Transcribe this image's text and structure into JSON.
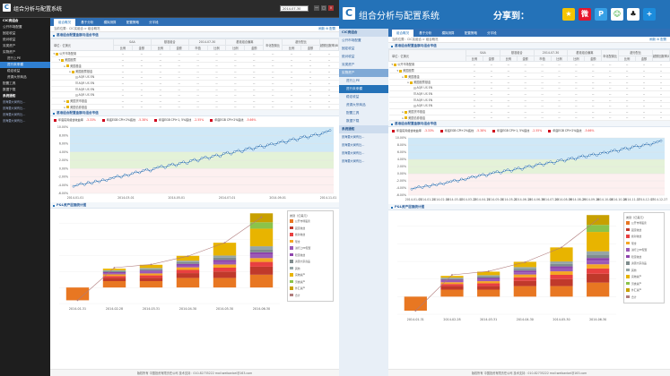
{
  "left": {
    "app_title": "组合分析与配置系统",
    "date": "2014-07-30",
    "win_buttons": [
      "—",
      "□",
      "×"
    ],
    "sidebar": [
      {
        "label": "CIC资组合",
        "cls": "hdr"
      },
      {
        "label": "公开市场配置",
        "cls": ""
      },
      {
        "label": "固定收益",
        "cls": ""
      },
      {
        "label": "绝对收益",
        "cls": ""
      },
      {
        "label": "另类资产",
        "cls": ""
      },
      {
        "label": "实物资产",
        "cls": ""
      },
      {
        "label": "进行上PE",
        "cls": "sub"
      },
      {
        "label": "进行未来模",
        "cls": "sub sel"
      },
      {
        "label": "稳定收益",
        "cls": "sub"
      },
      {
        "label": "资源大宗商品",
        "cls": "sub"
      },
      {
        "label": "配置工具",
        "cls": ""
      },
      {
        "label": "数据下载",
        "cls": ""
      },
      {
        "label": "系统通知",
        "cls": "hdr"
      },
      {
        "label": "张海要大局有比...",
        "cls": "ns"
      },
      {
        "label": "张海要大局有比...",
        "cls": "ns"
      },
      {
        "label": "张海要大局有比...",
        "cls": "ns"
      },
      {
        "label": "张海要大局有比...",
        "cls": "ns"
      }
    ]
  },
  "right": {
    "app_title": "组合分析与配置系统",
    "share_label": "分享到：",
    "share_icons": [
      {
        "name": "qzone",
        "glyph": "★",
        "bg": "#f5c400",
        "fg": "#fff"
      },
      {
        "name": "weibo",
        "glyph": "微",
        "bg": "#e6162d",
        "fg": "#fff"
      },
      {
        "name": "tencent-weibo",
        "glyph": "P",
        "bg": "#37a0e6",
        "fg": "#fff"
      },
      {
        "name": "wechat",
        "glyph": "☺",
        "bg": "#fff",
        "fg": "#2aa52a"
      },
      {
        "name": "qq",
        "glyph": "♣",
        "bg": "#fff",
        "fg": "#111"
      },
      {
        "name": "more",
        "glyph": "+",
        "bg": "#1c8cdc",
        "fg": "#fff"
      }
    ],
    "sidebar": [
      {
        "label": "CIC资组合",
        "cls": "hdr"
      },
      {
        "label": "公开市场配置",
        "cls": ""
      },
      {
        "label": "固定收益",
        "cls": ""
      },
      {
        "label": "绝对收益",
        "cls": ""
      },
      {
        "label": "另类资产",
        "cls": ""
      },
      {
        "label": "实物资产",
        "cls": "hdr2"
      },
      {
        "label": "进行上PE",
        "cls": "sub"
      },
      {
        "label": "进行未来模",
        "cls": "sub sel"
      },
      {
        "label": "稳定收益",
        "cls": "sub"
      },
      {
        "label": "资源大宗商品",
        "cls": "sub"
      },
      {
        "label": "配置工具",
        "cls": "sub"
      },
      {
        "label": "数据下载",
        "cls": "sub"
      },
      {
        "label": "系统通知",
        "cls": "hdr"
      },
      {
        "label": "张海要大局有比...",
        "cls": "ns"
      },
      {
        "label": "张海要大局有比...",
        "cls": "ns"
      },
      {
        "label": "张海要大局有比...",
        "cls": "ns"
      },
      {
        "label": "张海要大局有比...",
        "cls": "ns"
      }
    ]
  },
  "tabs": [
    "组合概况",
    "基于分析",
    "模拟测算",
    "配置策略",
    "分字段"
  ],
  "breadcrumb": "当前位置：CIC实组合 > 组合概况",
  "crumb_right": "刷新  ⚙ 配置",
  "section1": "基准组合配置金额与组合市值",
  "table": {
    "unit": "单位：亿美元",
    "group_headers": [
      "SAA",
      "基准组合",
      "2014-07-30",
      "基准组合偏离",
      "年化配置比",
      "超分配比",
      "超额回报率(BPS)"
    ],
    "sub_headers": [
      "比例",
      "金额",
      "比例",
      "金额",
      "市值",
      "比例",
      "比例",
      "金额"
    ],
    "rows": [
      {
        "name": "公开市场配置",
        "level": 0,
        "icon": "#e8b400",
        "arrow": "▾",
        "vals": [
          "--",
          "--",
          "--",
          "--",
          "--",
          "--",
          "--",
          "--",
          "--",
          "--",
          "--",
          "--"
        ]
      },
      {
        "name": "美国股票",
        "level": 1,
        "icon": "#e8b400",
        "arrow": "▾",
        "vals": [
          "--",
          "--",
          "--",
          "--",
          "--",
          "--",
          "--",
          "--",
          "--",
          "--",
          "--",
          "--"
        ]
      },
      {
        "name": "美国基金",
        "level": 2,
        "icon": "#e8b400",
        "arrow": "▸",
        "vals": [
          "--",
          "--",
          "--",
          "--",
          "--",
          "--",
          "--",
          "--",
          "--",
          "--",
          "--",
          "--"
        ]
      },
      {
        "name": "美国股票基金",
        "level": 3,
        "icon": "#e8b400",
        "arrow": "▸",
        "vals": [
          "--",
          "--",
          "--",
          "--",
          "--",
          "--",
          "--",
          "--",
          "--",
          "--",
          "--",
          "--"
        ]
      },
      {
        "name": "AQR US EN",
        "level": 4,
        "icon": "#cfcfcf",
        "arrow": "",
        "vals": [
          "--",
          "--",
          "--",
          "--",
          "--",
          "--",
          "--",
          "--",
          "--",
          "--",
          "--",
          "--"
        ]
      },
      {
        "name": "AQR US EN",
        "level": 4,
        "icon": "#cfcfcf",
        "arrow": "",
        "vals": [
          "--",
          "--",
          "--",
          "--",
          "--",
          "--",
          "--",
          "--",
          "--",
          "--",
          "--",
          "--"
        ]
      },
      {
        "name": "AQR US EN",
        "level": 4,
        "icon": "#cfcfcf",
        "arrow": "",
        "vals": [
          "--",
          "--",
          "--",
          "--",
          "--",
          "--",
          "--",
          "--",
          "--",
          "--",
          "--",
          "--"
        ]
      },
      {
        "name": "AQR US EN",
        "level": 4,
        "icon": "#cfcfcf",
        "arrow": "",
        "vals": [
          "--",
          "--",
          "--",
          "--",
          "--",
          "--",
          "--",
          "--",
          "--",
          "--",
          "--",
          "--"
        ]
      },
      {
        "name": "美国货币基金",
        "level": 2,
        "icon": "#e8b400",
        "arrow": "▸",
        "vals": [
          "--",
          "--",
          "--",
          "--",
          "--",
          "--",
          "--",
          "--",
          "--",
          "--",
          "--",
          "--"
        ]
      },
      {
        "name": "美国债券基金",
        "level": 2,
        "icon": "#e8b400",
        "arrow": "▸",
        "vals": [
          "--",
          "--",
          "--",
          "--",
          "--",
          "--",
          "--",
          "--",
          "--",
          "--",
          "--",
          "--"
        ]
      }
    ]
  },
  "section2": "基准组合配置金额与组合市值",
  "section3": "P&L资产层面统计图",
  "line_legend": [
    {
      "label": "年底实际组合收益率",
      "val": "-3.33%",
      "color": "#d0021b"
    },
    {
      "label": "年底EGB CPI+2%底线",
      "val": "-5.38%",
      "color": "#d0021b"
    },
    {
      "label": "年底EGB CPI+1, 5%底线",
      "val": "-2.55%",
      "color": "#d0021b"
    },
    {
      "label": "年底EGB CPI+2%底线",
      "val": "-5.66%",
      "color": "#d0021b"
    }
  ],
  "bar_legend_title": "类别（亿美元）",
  "footer": "版权所有 中国投资有限责任公司  技术支持：010-82735222  mail:weibanbei@163.com",
  "colors": {
    "accent": "#2472b8",
    "bar_up": "#e87722",
    "line": "#2a6fb0"
  },
  "chart_data": [
    {
      "type": "line",
      "title": "",
      "x": [
        "2014-01-01",
        "2014-02-01",
        "2014-03-01",
        "2014-04-01",
        "2014-05-01",
        "2014-06-01",
        "2014-07-01",
        "2014-08-01",
        "2014-09-01",
        "2014-10-01",
        "2014-11-01",
        "2014-12-01"
      ],
      "x_ticks_left": [
        "2014-01-01",
        "2014-03-01",
        "2014-05-01",
        "2014-07-01",
        "2014-09-01",
        "2014-11-01"
      ],
      "x_ticks_right": [
        "2014-01-01",
        "2014-01-21",
        "2014-02-10",
        "2014-03-02",
        "2014-03-22",
        "2014-04-11",
        "2014-05-01",
        "2014-05-21",
        "2014-06-10",
        "2014-06-30",
        "2014-07-20",
        "2014-08-09",
        "2014-08-29",
        "2014-09-18",
        "2014-10-08",
        "2014-10-28",
        "2014-11-17",
        "2014-12-07",
        "2014-12-27"
      ],
      "ylim": [
        -6,
        10
      ],
      "yticks": [
        "10.00%",
        "8.00%",
        "6.00%",
        "4.00%",
        "2.00%",
        "0.00%",
        "-2.00%",
        "-4.00%",
        "-6.00%"
      ],
      "bands": [
        {
          "from": 4,
          "to": 10,
          "color": "#cfe8f7"
        },
        {
          "from": 0,
          "to": 4,
          "color": "#e4f2d8"
        },
        {
          "from": -6,
          "to": 0,
          "color": "#fdf0f0"
        }
      ],
      "series": [
        {
          "values": [
            -4.3,
            -4.0,
            -3.6,
            -3.9,
            -3.3,
            -3.6,
            -3.0,
            -3.2,
            -2.7,
            -2.9,
            -2.4,
            -2.2,
            -1.8,
            -2.1,
            -1.5,
            -1.7,
            -1.2,
            -0.8,
            -1.0,
            -0.5,
            -0.2,
            -0.6,
            0.0,
            0.3,
            0.6,
            0.2,
            0.8,
            1.1,
            0.7,
            1.3,
            1.6,
            1.2,
            1.9,
            2.2,
            1.8,
            2.5,
            2.8,
            2.4,
            3.0,
            3.3,
            2.9,
            3.6,
            3.9,
            3.5,
            4.1,
            4.4,
            4.0,
            4.7,
            5.0,
            4.6,
            5.2,
            5.5,
            5.1,
            5.7,
            6.0,
            5.8,
            6.3,
            6.6,
            6.2,
            6.9,
            7.2,
            6.8,
            7.5,
            7.8,
            7.4,
            8.0,
            8.3,
            8.0,
            8.6,
            8.9,
            9.2
          ]
        }
      ]
    },
    {
      "type": "bar",
      "title": "",
      "categories": [
        "2014-01-31",
        "2014-02-28",
        "2014-03-31",
        "2014-04-30",
        "2014-05-30",
        "2014-06-30"
      ],
      "ylim": [
        -5,
        23
      ],
      "series": [
        {
          "name": "公开市场股票",
          "color": "#e87722",
          "values": [
            -4.0,
            2.0,
            2.0,
            3.0,
            3.0,
            4.0
          ]
        },
        {
          "name": "固定收益",
          "color": "#c0392b",
          "values": [
            0,
            1.0,
            1.0,
            1.5,
            2.0,
            2.5
          ]
        },
        {
          "name": "绝对收益",
          "color": "#e84040",
          "values": [
            0,
            0.6,
            0.8,
            1.0,
            1.2,
            1.5
          ]
        },
        {
          "name": "现金",
          "color": "#f5a623",
          "values": [
            0,
            0.5,
            0.6,
            0.8,
            1.0,
            1.2
          ]
        },
        {
          "name": "进行上PE配置",
          "color": "#9b59b6",
          "values": [
            0,
            0.4,
            0.5,
            0.6,
            0.8,
            1.0
          ]
        },
        {
          "name": "稳定收益",
          "color": "#8e44ad",
          "values": [
            0,
            0.3,
            0.4,
            0.5,
            0.6,
            0.8
          ]
        },
        {
          "name": "资源大宗商品",
          "color": "#7f8c8d",
          "values": [
            0,
            0.3,
            0.4,
            0.5,
            0.7,
            0.9
          ]
        },
        {
          "name": "其他",
          "color": "#95a5a6",
          "values": [
            0,
            0.3,
            0.4,
            0.5,
            0.7,
            1.0
          ]
        },
        {
          "name": "实物资产",
          "color": "#e8b400",
          "values": [
            0,
            0.5,
            1.0,
            1.5,
            4.0,
            5.5
          ]
        },
        {
          "name": "另类资产",
          "color": "#8bc34a",
          "values": [
            0,
            0,
            0,
            0,
            0,
            2.0
          ]
        },
        {
          "name": "外汇资产",
          "color": "#c8a000",
          "values": [
            0,
            0,
            0,
            0,
            0,
            2.8
          ]
        },
        {
          "name": "合计",
          "color": "#b07c7c",
          "values": [
            -4.0,
            6.2,
            7.2,
            9.8,
            14.0,
            22.0
          ],
          "line": true
        }
      ]
    }
  ]
}
